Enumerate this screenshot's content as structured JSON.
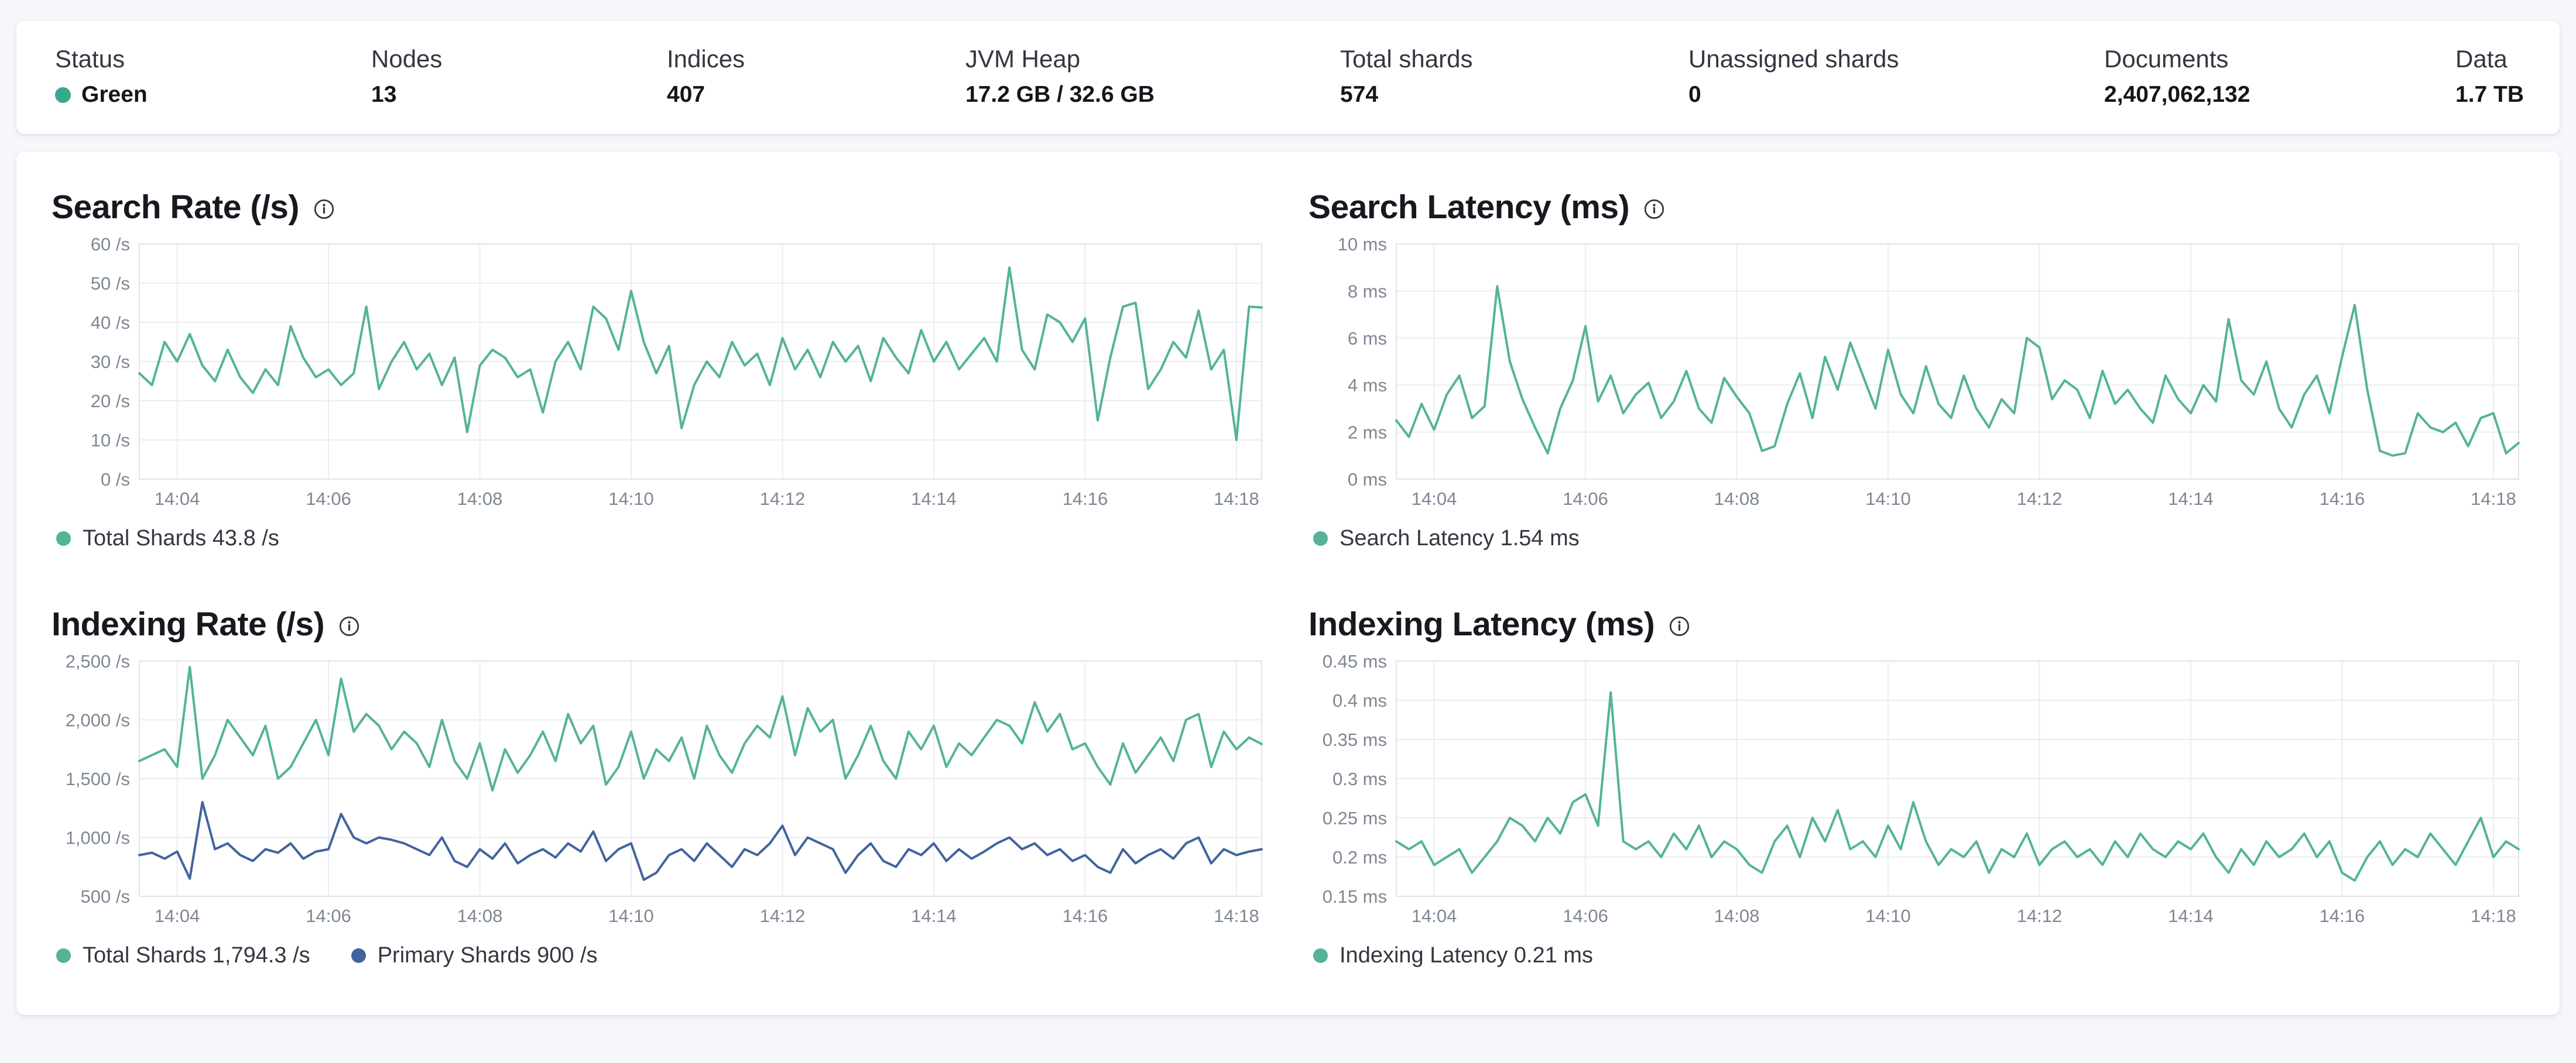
{
  "status_bar": {
    "items": [
      {
        "label": "Status",
        "value": "Green",
        "dot_color": "#3aa78f"
      },
      {
        "label": "Nodes",
        "value": "13"
      },
      {
        "label": "Indices",
        "value": "407"
      },
      {
        "label": "JVM Heap",
        "value": "17.2 GB / 32.6 GB"
      },
      {
        "label": "Total shards",
        "value": "574"
      },
      {
        "label": "Unassigned shards",
        "value": "0"
      },
      {
        "label": "Documents",
        "value": "2,407,062,132"
      },
      {
        "label": "Data",
        "value": "1.7 TB"
      }
    ]
  },
  "colors": {
    "teal": "#54B399",
    "blue": "#41639E"
  },
  "chart_data": [
    {
      "type": "line",
      "title": "Search Rate (/s)",
      "ylim": [
        0,
        60
      ],
      "y_ticks": [
        {
          "v": 0,
          "label": "0 /s"
        },
        {
          "v": 10,
          "label": "10 /s"
        },
        {
          "v": 20,
          "label": "20 /s"
        },
        {
          "v": 30,
          "label": "30 /s"
        },
        {
          "v": 40,
          "label": "40 /s"
        },
        {
          "v": 50,
          "label": "50 /s"
        },
        {
          "v": 60,
          "label": "60 /s"
        }
      ],
      "x_ticks": [
        {
          "i": 3,
          "label": "14:04"
        },
        {
          "i": 15,
          "label": "14:06"
        },
        {
          "i": 27,
          "label": "14:08"
        },
        {
          "i": 39,
          "label": "14:10"
        },
        {
          "i": 51,
          "label": "14:12"
        },
        {
          "i": 63,
          "label": "14:14"
        },
        {
          "i": 75,
          "label": "14:16"
        },
        {
          "i": 87,
          "label": "14:18"
        }
      ],
      "series": [
        {
          "name": "Total Shards",
          "color": "#54B399",
          "values": [
            27,
            24,
            35,
            30,
            37,
            29,
            25,
            33,
            26,
            22,
            28,
            24,
            39,
            31,
            26,
            28,
            24,
            27,
            44,
            23,
            30,
            35,
            28,
            32,
            24,
            31,
            12,
            29,
            33,
            31,
            26,
            28,
            17,
            30,
            35,
            28,
            44,
            41,
            33,
            48,
            35,
            27,
            34,
            13,
            24,
            30,
            26,
            35,
            29,
            32,
            24,
            36,
            28,
            33,
            26,
            35,
            30,
            34,
            25,
            36,
            31,
            27,
            38,
            30,
            35,
            28,
            32,
            36,
            30,
            54,
            33,
            28,
            42,
            40,
            35,
            41,
            15,
            31,
            44,
            45,
            23,
            28,
            35,
            31,
            43,
            28,
            33,
            10,
            44,
            43.8
          ]
        }
      ],
      "legend": [
        {
          "label": "Total Shards 43.8 /s",
          "color": "#54B399"
        }
      ]
    },
    {
      "type": "line",
      "title": "Search Latency (ms)",
      "ylim": [
        0,
        10
      ],
      "y_ticks": [
        {
          "v": 0,
          "label": "0 ms"
        },
        {
          "v": 2,
          "label": "2 ms"
        },
        {
          "v": 4,
          "label": "4 ms"
        },
        {
          "v": 6,
          "label": "6 ms"
        },
        {
          "v": 8,
          "label": "8 ms"
        },
        {
          "v": 10,
          "label": "10 ms"
        }
      ],
      "x_ticks": [
        {
          "i": 3,
          "label": "14:04"
        },
        {
          "i": 15,
          "label": "14:06"
        },
        {
          "i": 27,
          "label": "14:08"
        },
        {
          "i": 39,
          "label": "14:10"
        },
        {
          "i": 51,
          "label": "14:12"
        },
        {
          "i": 63,
          "label": "14:14"
        },
        {
          "i": 75,
          "label": "14:16"
        },
        {
          "i": 87,
          "label": "14:18"
        }
      ],
      "series": [
        {
          "name": "Search Latency",
          "color": "#54B399",
          "values": [
            2.5,
            1.8,
            3.2,
            2.1,
            3.6,
            4.4,
            2.6,
            3.1,
            8.2,
            5.0,
            3.4,
            2.2,
            1.1,
            3.0,
            4.2,
            6.5,
            3.3,
            4.4,
            2.8,
            3.6,
            4.1,
            2.6,
            3.3,
            4.6,
            3.0,
            2.4,
            4.3,
            3.5,
            2.8,
            1.2,
            1.4,
            3.2,
            4.5,
            2.6,
            5.2,
            3.8,
            5.8,
            4.4,
            3.0,
            5.5,
            3.6,
            2.8,
            4.8,
            3.2,
            2.6,
            4.4,
            3.0,
            2.2,
            3.4,
            2.8,
            6.0,
            5.6,
            3.4,
            4.2,
            3.8,
            2.6,
            4.6,
            3.2,
            3.8,
            3.0,
            2.4,
            4.4,
            3.4,
            2.8,
            4.0,
            3.3,
            6.8,
            4.2,
            3.6,
            5.0,
            3.0,
            2.2,
            3.6,
            4.4,
            2.8,
            5.2,
            7.4,
            3.8,
            1.2,
            1.0,
            1.1,
            2.8,
            2.2,
            2.0,
            2.4,
            1.4,
            2.6,
            2.8,
            1.1,
            1.54
          ]
        }
      ],
      "legend": [
        {
          "label": "Search Latency 1.54 ms",
          "color": "#54B399"
        }
      ]
    },
    {
      "type": "line",
      "title": "Indexing Rate (/s)",
      "ylim": [
        500,
        2500
      ],
      "y_ticks": [
        {
          "v": 500,
          "label": "500 /s"
        },
        {
          "v": 1000,
          "label": "1,000 /s"
        },
        {
          "v": 1500,
          "label": "1,500 /s"
        },
        {
          "v": 2000,
          "label": "2,000 /s"
        },
        {
          "v": 2500,
          "label": "2,500 /s"
        }
      ],
      "x_ticks": [
        {
          "i": 3,
          "label": "14:04"
        },
        {
          "i": 15,
          "label": "14:06"
        },
        {
          "i": 27,
          "label": "14:08"
        },
        {
          "i": 39,
          "label": "14:10"
        },
        {
          "i": 51,
          "label": "14:12"
        },
        {
          "i": 63,
          "label": "14:14"
        },
        {
          "i": 75,
          "label": "14:16"
        },
        {
          "i": 87,
          "label": "14:18"
        }
      ],
      "series": [
        {
          "name": "Total Shards",
          "color": "#54B399",
          "values": [
            1650,
            1700,
            1750,
            1600,
            2450,
            1500,
            1700,
            2000,
            1850,
            1700,
            1950,
            1500,
            1600,
            1800,
            2000,
            1700,
            2350,
            1900,
            2050,
            1950,
            1750,
            1900,
            1800,
            1600,
            2000,
            1650,
            1500,
            1800,
            1400,
            1750,
            1550,
            1700,
            1900,
            1650,
            2050,
            1800,
            1950,
            1450,
            1600,
            1900,
            1500,
            1750,
            1650,
            1850,
            1500,
            1950,
            1700,
            1550,
            1800,
            1950,
            1850,
            2200,
            1700,
            2100,
            1900,
            2000,
            1500,
            1700,
            1950,
            1650,
            1500,
            1900,
            1750,
            1950,
            1600,
            1800,
            1700,
            1850,
            2000,
            1950,
            1800,
            2150,
            1900,
            2050,
            1750,
            1800,
            1600,
            1450,
            1800,
            1550,
            1700,
            1850,
            1650,
            2000,
            2050,
            1600,
            1900,
            1750,
            1850,
            1794.3
          ]
        },
        {
          "name": "Primary Shards",
          "color": "#41639E",
          "values": [
            850,
            870,
            820,
            880,
            650,
            1300,
            900,
            950,
            850,
            800,
            900,
            870,
            950,
            820,
            880,
            900,
            1200,
            1000,
            950,
            1000,
            980,
            950,
            900,
            850,
            1000,
            800,
            750,
            900,
            820,
            950,
            780,
            850,
            900,
            830,
            950,
            880,
            1050,
            800,
            900,
            950,
            640,
            700,
            850,
            900,
            800,
            950,
            850,
            750,
            900,
            850,
            950,
            1100,
            850,
            1000,
            950,
            900,
            700,
            850,
            950,
            800,
            750,
            900,
            850,
            950,
            800,
            900,
            820,
            880,
            950,
            1000,
            900,
            950,
            850,
            900,
            800,
            850,
            750,
            700,
            900,
            780,
            850,
            900,
            820,
            950,
            1000,
            780,
            900,
            850,
            880,
            900
          ]
        }
      ],
      "legend": [
        {
          "label": "Total Shards 1,794.3 /s",
          "color": "#54B399"
        },
        {
          "label": "Primary Shards 900 /s",
          "color": "#41639E"
        }
      ]
    },
    {
      "type": "line",
      "title": "Indexing Latency (ms)",
      "ylim": [
        0.15,
        0.45
      ],
      "y_ticks": [
        {
          "v": 0.15,
          "label": "0.15 ms"
        },
        {
          "v": 0.2,
          "label": "0.2 ms"
        },
        {
          "v": 0.25,
          "label": "0.25 ms"
        },
        {
          "v": 0.3,
          "label": "0.3 ms"
        },
        {
          "v": 0.35,
          "label": "0.35 ms"
        },
        {
          "v": 0.4,
          "label": "0.4 ms"
        },
        {
          "v": 0.45,
          "label": "0.45 ms"
        }
      ],
      "x_ticks": [
        {
          "i": 3,
          "label": "14:04"
        },
        {
          "i": 15,
          "label": "14:06"
        },
        {
          "i": 27,
          "label": "14:08"
        },
        {
          "i": 39,
          "label": "14:10"
        },
        {
          "i": 51,
          "label": "14:12"
        },
        {
          "i": 63,
          "label": "14:14"
        },
        {
          "i": 75,
          "label": "14:16"
        },
        {
          "i": 87,
          "label": "14:18"
        }
      ],
      "series": [
        {
          "name": "Indexing Latency",
          "color": "#54B399",
          "values": [
            0.22,
            0.21,
            0.22,
            0.19,
            0.2,
            0.21,
            0.18,
            0.2,
            0.22,
            0.25,
            0.24,
            0.22,
            0.25,
            0.23,
            0.27,
            0.28,
            0.24,
            0.41,
            0.22,
            0.21,
            0.22,
            0.2,
            0.23,
            0.21,
            0.24,
            0.2,
            0.22,
            0.21,
            0.19,
            0.18,
            0.22,
            0.24,
            0.2,
            0.25,
            0.22,
            0.26,
            0.21,
            0.22,
            0.2,
            0.24,
            0.21,
            0.27,
            0.22,
            0.19,
            0.21,
            0.2,
            0.22,
            0.18,
            0.21,
            0.2,
            0.23,
            0.19,
            0.21,
            0.22,
            0.2,
            0.21,
            0.19,
            0.22,
            0.2,
            0.23,
            0.21,
            0.2,
            0.22,
            0.21,
            0.23,
            0.2,
            0.18,
            0.21,
            0.19,
            0.22,
            0.2,
            0.21,
            0.23,
            0.2,
            0.22,
            0.18,
            0.17,
            0.2,
            0.22,
            0.19,
            0.21,
            0.2,
            0.23,
            0.21,
            0.19,
            0.22,
            0.25,
            0.2,
            0.22,
            0.21
          ]
        }
      ],
      "legend": [
        {
          "label": "Indexing Latency 0.21 ms",
          "color": "#54B399"
        }
      ]
    }
  ]
}
